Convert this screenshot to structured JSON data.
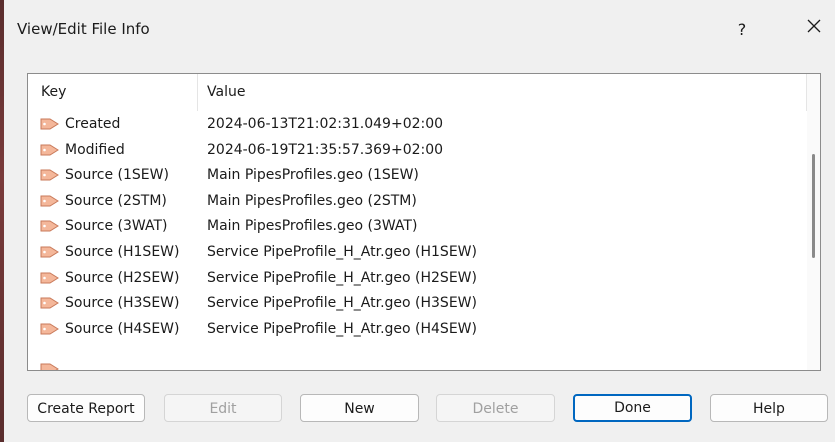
{
  "window": {
    "title": "View/Edit File Info",
    "help_label": "?"
  },
  "table": {
    "columns": [
      "Key",
      "Value"
    ],
    "rows": [
      {
        "key": "Created",
        "value": "2024-06-13T21:02:31.049+02:00"
      },
      {
        "key": "Modified",
        "value": "2024-06-19T21:35:57.369+02:00"
      },
      {
        "key": "Source (1SEW)",
        "value": "Main PipesProfiles.geo (1SEW)"
      },
      {
        "key": "Source (2STM)",
        "value": "Main PipesProfiles.geo (2STM)"
      },
      {
        "key": "Source (3WAT)",
        "value": "Main PipesProfiles.geo (3WAT)"
      },
      {
        "key": "Source (H1SEW)",
        "value": "Service PipeProfile_H_Atr.geo (H1SEW)"
      },
      {
        "key": "Source (H2SEW)",
        "value": "Service PipeProfile_H_Atr.geo (H2SEW)"
      },
      {
        "key": "Source (H3SEW)",
        "value": "Service PipeProfile_H_Atr.geo (H3SEW)"
      },
      {
        "key": "Source (H4SEW)",
        "value": "Service PipeProfile_H_Atr.geo (H4SEW)"
      }
    ]
  },
  "buttons": {
    "create_report": "Create Report",
    "edit": "Edit",
    "new": "New",
    "delete": "Delete",
    "done": "Done",
    "help": "Help"
  },
  "icons": {
    "row_icon": "tag-icon",
    "close": "close-icon"
  },
  "colors": {
    "accent": "#0067c0",
    "tag_fill": "#f4b79a",
    "tag_stroke": "#c97a5a"
  }
}
